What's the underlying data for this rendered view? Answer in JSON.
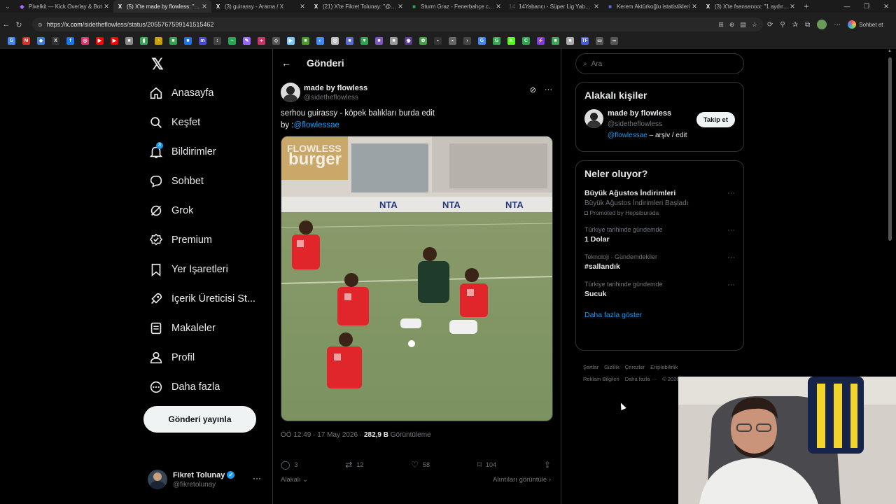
{
  "browser": {
    "tabs": [
      {
        "title": "Pixelkit — Kick Overlay & Bot",
        "fav_color": "#a36bff",
        "fav": "◆"
      },
      {
        "title": "(5) X'te made by flowless: \"serho",
        "fav_color": "#ffffff",
        "fav": "X",
        "active": true
      },
      {
        "title": "(3) guirassy - Arama / X",
        "fav_color": "#ffffff",
        "fav": "X"
      },
      {
        "title": "(21) X'te Fikret Tolunay: \"@keyc",
        "fav_color": "#ffffff",
        "fav": "X"
      },
      {
        "title": "Sturm Graz - Fenerbahçe canlı",
        "fav_color": "#2ea44f",
        "fav": "■"
      },
      {
        "title": "14Yabancı - Süper Lig Yabancı İ",
        "fav_color": "#444444",
        "fav": "14"
      },
      {
        "title": "Kerem Aktürkoğlu istatistikleri",
        "fav_color": "#5b6bd6",
        "fav": "■"
      },
      {
        "title": "(3) X'te fsenserxxx: \"1 aydır Fen",
        "fav_color": "#ffffff",
        "fav": "X"
      }
    ],
    "url_prefix": "https://",
    "url_host": "x.com",
    "url_path": "/sidetheflowless/status/2055767599141515462",
    "sohbet_label": "Sohbet et",
    "bookmarks": [
      {
        "label": "G",
        "color": "#4285f4"
      },
      {
        "label": "M",
        "color": "#d93025"
      },
      {
        "label": "◆",
        "color": "#3c7bd6"
      },
      {
        "label": "X",
        "color": "#333333"
      },
      {
        "label": "f",
        "color": "#1877f2"
      },
      {
        "label": "◎",
        "color": "#e1306c"
      },
      {
        "label": "▶",
        "color": "#ff0000"
      },
      {
        "label": "▶",
        "color": "#ff0000"
      },
      {
        "label": "■",
        "color": "#888888"
      },
      {
        "label": "▮",
        "color": "#3aa757"
      },
      {
        "label": "◔",
        "color": "#caa000"
      },
      {
        "label": "■",
        "color": "#2ea44f"
      },
      {
        "label": "■",
        "color": "#1a73e8"
      },
      {
        "label": "m",
        "color": "#4a4ad8"
      },
      {
        "label": "↕",
        "color": "#444444"
      },
      {
        "label": "~",
        "color": "#22aa55"
      },
      {
        "label": "✎",
        "color": "#9966ff"
      },
      {
        "label": "⌖",
        "color": "#cc3366"
      },
      {
        "label": "◇",
        "color": "#555555"
      },
      {
        "label": "▶",
        "color": "#7ec8ff"
      },
      {
        "label": "■",
        "color": "#4c9a2a"
      },
      {
        "label": "◐",
        "color": "#3d8bff"
      },
      {
        "label": "◎",
        "color": "#bbbbbb"
      },
      {
        "label": "■",
        "color": "#5b6bd6"
      },
      {
        "label": "▼",
        "color": "#2ea44f"
      },
      {
        "label": "■",
        "color": "#7e57c2"
      },
      {
        "label": "■",
        "color": "#999999"
      },
      {
        "label": "◉",
        "color": "#5a3c8a"
      },
      {
        "label": "✿",
        "color": "#43a047"
      },
      {
        "label": "▪",
        "color": "#333333"
      },
      {
        "label": "▪",
        "color": "#666666"
      },
      {
        "label": "›",
        "color": "#444444"
      },
      {
        "label": "G",
        "color": "#4285f4"
      },
      {
        "label": "G",
        "color": "#34a853"
      },
      {
        "label": "K",
        "color": "#53fc18"
      },
      {
        "label": "C",
        "color": "#2ea44f"
      },
      {
        "label": "⚡",
        "color": "#7c3aed"
      },
      {
        "label": "■",
        "color": "#3aa757"
      },
      {
        "label": "■",
        "color": "#aaaaaa"
      },
      {
        "label": "TF",
        "color": "#4b5bd6"
      },
      {
        "label": "▭",
        "color": "#555555"
      },
      {
        "label": "∞",
        "color": "#555555"
      }
    ]
  },
  "nav": {
    "items": [
      {
        "label": "Anasayfa",
        "icon": "home-icon"
      },
      {
        "label": "Keşfet",
        "icon": "search-icon"
      },
      {
        "label": "Bildirimler",
        "icon": "bell-icon",
        "badge": "3"
      },
      {
        "label": "Sohbet",
        "icon": "chat-icon"
      },
      {
        "label": "Grok",
        "icon": "grok-icon"
      },
      {
        "label": "Premium",
        "icon": "premium-icon"
      },
      {
        "label": "Yer İşaretleri",
        "icon": "bookmark-icon"
      },
      {
        "label": "İçerik Üreticisi St...",
        "icon": "rocket-icon"
      },
      {
        "label": "Makaleler",
        "icon": "article-icon"
      },
      {
        "label": "Profil",
        "icon": "profile-icon"
      },
      {
        "label": "Daha fazla",
        "icon": "more-circle-icon"
      }
    ],
    "post_button": "Gönderi yayınla",
    "account": {
      "name": "Fikret Tolunay",
      "handle": "@fikretolunay",
      "more": "···"
    }
  },
  "post": {
    "header_title": "Gönderi",
    "author_name": "made by flowless",
    "author_handle": "@sidetheflowless",
    "text_line1": "serhou guirassy - köpek balıkları burda edit",
    "text_by": "by :",
    "text_mention": "@flowlessae",
    "media_watermark": "FLOWLESS",
    "time": "ÖÖ 12:49 · 17 May 2026",
    "views_count": "282,9 B",
    "views_label": "Görüntüleme",
    "replies": "3",
    "reposts": "12",
    "likes": "58",
    "bookmarks": "104",
    "reply_filter": "Alakalı",
    "quotes_link": "Alıntıları görüntüle"
  },
  "sidebar": {
    "search_placeholder": "Ara",
    "relevant": {
      "title": "Alakalı kişiler",
      "name": "made by flowless",
      "handle": "@sidetheflowless",
      "bio_mention": "@flowlessae",
      "bio_rest": " – arşiv / edit",
      "follow": "Takip et"
    },
    "trends": {
      "title": "Neler oluyor?",
      "items": [
        {
          "context": "",
          "topic": "Büyük Ağustos İndirimleri",
          "sub": "Büyük Ağustos İndirimleri Başladı",
          "promo": "Promoted by Hepsiburada"
        },
        {
          "context": "Türkiye tarihinde gündemde",
          "topic": "1 Dolar",
          "sub": "",
          "promo": ""
        },
        {
          "context": "Teknoloji · Gündemdekiler",
          "topic": "#sallandık",
          "sub": "",
          "promo": ""
        },
        {
          "context": "Türkiye tarihinde gündemde",
          "topic": "Sucuk",
          "sub": "",
          "promo": ""
        }
      ],
      "more": "Daha fazla göster"
    },
    "footer": [
      "Şartlar",
      "Gizlilik",
      "Çerezler",
      "Erişilebilirlik",
      "Reklam Bilgileri",
      "Daha fazla ···",
      "© 2026 X"
    ]
  },
  "colors": {
    "accent": "#1d9bf0",
    "text": "#e7e9ea",
    "muted": "#71767b",
    "border": "#2f3336"
  }
}
